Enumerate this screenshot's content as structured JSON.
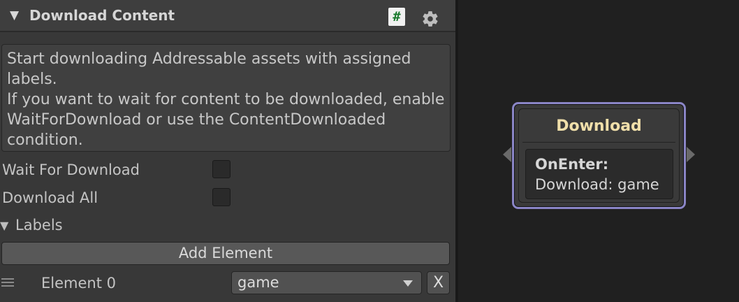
{
  "inspector": {
    "component_title": "Download Content",
    "script_icon_glyph": "#",
    "help_text": "Start downloading Addressable assets with assigned\nlabels.\nIf you want to wait for content to be downloaded, enable\nWaitForDownload or use the ContentDownloaded\ncondition.",
    "fields": {
      "wait_for_download": {
        "label": "Wait For Download",
        "checked": false
      },
      "download_all": {
        "label": "Download All",
        "checked": false
      }
    },
    "labels_section": {
      "title": "Labels",
      "add_element_label": "Add Element",
      "elements": [
        {
          "label": "Element 0",
          "value": "game",
          "remove_label": "X"
        }
      ]
    }
  },
  "graph": {
    "node": {
      "title": "Download",
      "event": "OnEnter:",
      "action": "Download: game",
      "border_color": "#8a85c6",
      "title_color": "#f0dfaa"
    }
  },
  "icons": [
    "fold-triangle-icon",
    "csharp-script-icon",
    "gear-icon",
    "drag-handle-icon",
    "dropdown-arrow-icon",
    "port-in-icon",
    "port-out-icon"
  ]
}
